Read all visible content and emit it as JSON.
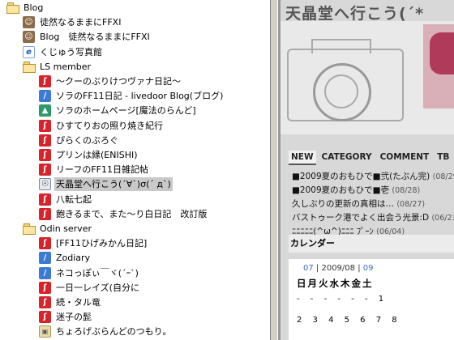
{
  "tree": {
    "rows": [
      {
        "label": "Blog",
        "icon": "folder-icon",
        "indent": 0,
        "selected": false
      },
      {
        "label": "徒然なるままにFFXI",
        "icon": "face-feed-icon",
        "indent": 1,
        "selected": false
      },
      {
        "label": "Blog　徒然なるままにFFXI",
        "icon": "face-feed-icon",
        "indent": 1,
        "selected": false
      },
      {
        "label": "くじゅう写真館",
        "icon": "ie-page-icon",
        "indent": 1,
        "selected": false
      },
      {
        "label": "LS member",
        "icon": "folder-icon",
        "indent": 1,
        "selected": false
      },
      {
        "label": "～クーのぶりけつヴァナ日記～",
        "icon": "feed-icon",
        "indent": 2,
        "selected": false
      },
      {
        "label": "ソラのFF11日記 - livedoor Blog(ブログ)",
        "icon": "blue-feed-icon",
        "indent": 2,
        "selected": false
      },
      {
        "label": "ソラのホームページ[魔法のらんど]",
        "icon": "green-feed-icon",
        "indent": 2,
        "selected": false
      },
      {
        "label": "ひすてりおの照り焼き紀行",
        "icon": "feed-icon",
        "indent": 2,
        "selected": false
      },
      {
        "label": "ぴらくのぶろぐ",
        "icon": "feed-icon",
        "indent": 2,
        "selected": false
      },
      {
        "label": "プリンは縁(ENISHI)",
        "icon": "feed-icon",
        "indent": 2,
        "selected": false
      },
      {
        "label": "リーフのFF11日雑記帖",
        "icon": "feed-icon",
        "indent": 2,
        "selected": false
      },
      {
        "label": "天晶堂へ行こう(´∀`)σ(´ д`)",
        "icon": "lock-feed-icon",
        "indent": 2,
        "selected": true
      },
      {
        "label": "八転七起",
        "icon": "feed-icon",
        "indent": 2,
        "selected": false
      },
      {
        "label": "飽きるまで、また～り白日記　改訂版",
        "icon": "feed-icon",
        "indent": 2,
        "selected": false
      },
      {
        "label": "Odin server",
        "icon": "folder-icon",
        "indent": 1,
        "selected": false
      },
      {
        "label": "[FF11ひげみかん日記]",
        "icon": "feed-icon",
        "indent": 2,
        "selected": false
      },
      {
        "label": "Zodiary",
        "icon": "blue-feed-icon",
        "indent": 2,
        "selected": false
      },
      {
        "label": "ネコっぽぃ￣ヾ(´ｰ`)",
        "icon": "blue-feed-icon",
        "indent": 2,
        "selected": false
      },
      {
        "label": "一日一レイズ(自分に",
        "icon": "feed-icon",
        "indent": 2,
        "selected": false
      },
      {
        "label": "続・タル竜",
        "icon": "feed-icon",
        "indent": 2,
        "selected": false
      },
      {
        "label": "迷子の髭",
        "icon": "feed-icon",
        "indent": 2,
        "selected": false
      },
      {
        "label": "ちょろげぶらんどのつもり。",
        "icon": "image-feed-icon",
        "indent": 2,
        "selected": false
      }
    ]
  },
  "blog": {
    "title": "天晶堂へ行こう(´*",
    "nav": [
      "NEW",
      "CATEGORY",
      "COMMENT",
      "TB",
      "I"
    ],
    "posts": [
      {
        "text": "■2009夏のおもひで■弐(たぶん完)",
        "date": "(08/29)"
      },
      {
        "text": "■2009夏のおもひで■壱",
        "date": "(08/28)"
      },
      {
        "text": "久しぶりの更新の真相は…",
        "date": "(08/27)"
      },
      {
        "text": "バストゥーク港でよく出会う光景:D",
        "date": "(06/23)"
      },
      {
        "text": "ﾆﾆﾆﾆﾆ(^ω^)ﾆﾆﾆ ﾌﾟｰﾝ",
        "date": "(06/04)"
      }
    ],
    "calendar": {
      "heading": "カレンダー",
      "prev": "07",
      "current": "2009/08",
      "next": "09",
      "weekdays": "日月火水木金土",
      "row1": "- - - - - - 1",
      "row2": "2 3 4 5 6 7 8"
    }
  },
  "colors": {
    "selected_row": "#c9c9c9",
    "feed_red": "#d8232a",
    "link_blue": "#3b6fb6"
  }
}
